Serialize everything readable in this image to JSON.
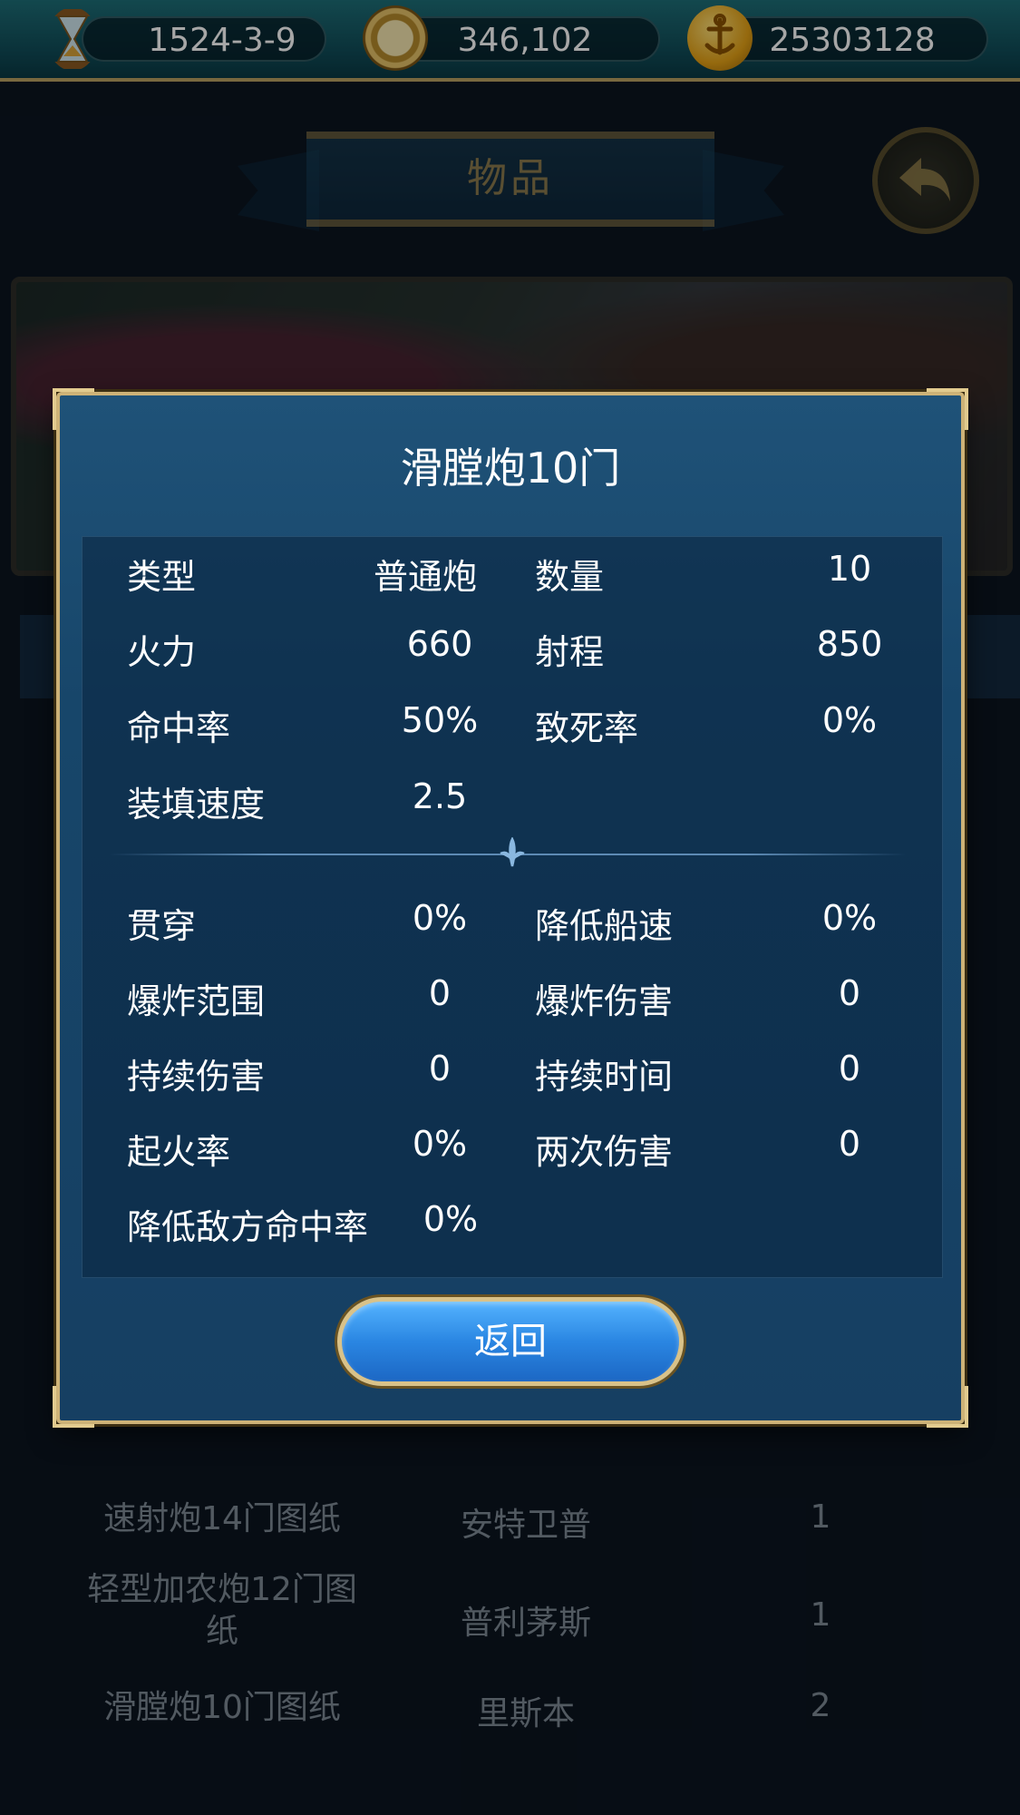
{
  "resources": {
    "date": "1524-3-9",
    "compass_value": "346,102",
    "gold": "25303128"
  },
  "page": {
    "title": "物品"
  },
  "background_list": [
    {
      "name": "速射炮14门图纸",
      "port": "安特卫普",
      "count": "1"
    },
    {
      "name": "轻型加农炮12门图纸",
      "port": "普利茅斯",
      "count": "1"
    },
    {
      "name": "滑膛炮10门图纸",
      "port": "里斯本",
      "count": "2"
    }
  ],
  "dialog": {
    "title": "滑膛炮10门",
    "stats_top": {
      "type_label": "类型",
      "type_value": "普通炮",
      "quantity_label": "数量",
      "quantity_value": "10",
      "firepower_label": "火力",
      "firepower_value": "660",
      "range_label": "射程",
      "range_value": "850",
      "accuracy_label": "命中率",
      "accuracy_value": "50%",
      "lethality_label": "致死率",
      "lethality_value": "0%",
      "reload_label": "装填速度",
      "reload_value": "2.5"
    },
    "stats_bottom": {
      "pierce_label": "贯穿",
      "pierce_value": "0%",
      "slow_label": "降低船速",
      "slow_value": "0%",
      "blast_range_label": "爆炸范围",
      "blast_range_value": "0",
      "blast_damage_label": "爆炸伤害",
      "blast_damage_value": "0",
      "dot_label": "持续伤害",
      "dot_value": "0",
      "duration_label": "持续时间",
      "duration_value": "0",
      "ignite_label": "起火率",
      "ignite_value": "0%",
      "double_label": "两次伤害",
      "double_value": "0",
      "reduce_hit_label": "降低敌方命中率",
      "reduce_hit_value": "0%"
    },
    "return_label": "返回"
  },
  "colors": {
    "accent_gold": "#cdb277",
    "button_blue": "#2a86e2"
  }
}
